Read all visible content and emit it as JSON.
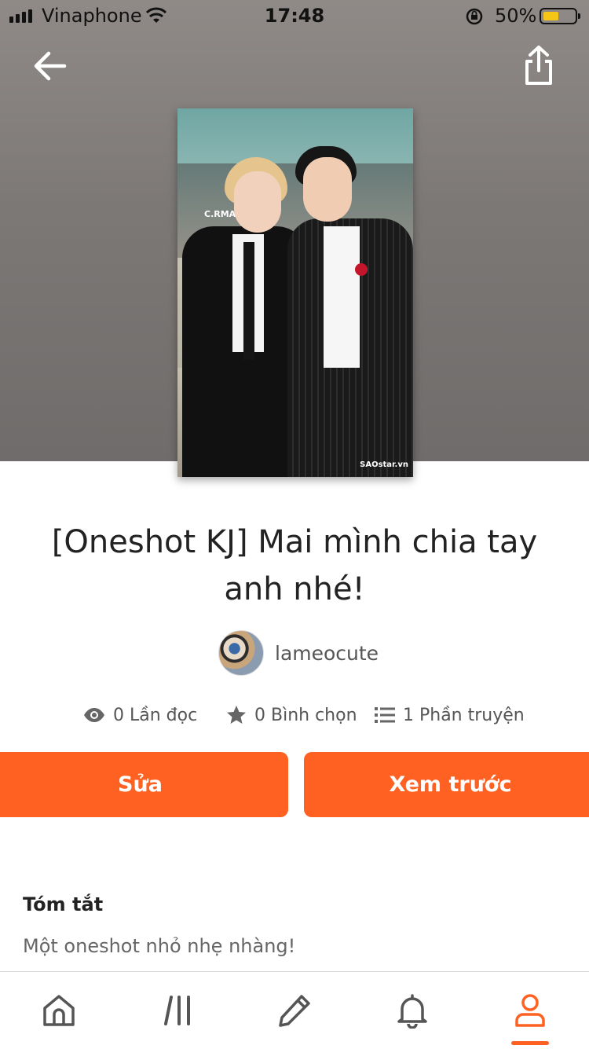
{
  "status_bar": {
    "carrier": "Vinaphone",
    "time": "17:48",
    "battery": "50%",
    "battery_level": 0.5
  },
  "header": {
    "back_icon": "arrow-left-icon",
    "share_icon": "share-icon"
  },
  "cover": {
    "sign_text": "C.RMAN",
    "watermark": "SAOstar.vn"
  },
  "story": {
    "title": "[Oneshot KJ] Mai mình chia tay anh nhé!",
    "author": "lameocute",
    "stats": {
      "reads": "0 Lần đọc",
      "votes": "0 Bình chọn",
      "parts": "1 Phần truyện"
    }
  },
  "actions": {
    "edit_label": "Sửa",
    "preview_label": "Xem trước"
  },
  "summary": {
    "heading": "Tóm tắt",
    "text": "Một oneshot nhỏ nhẹ nhàng!"
  },
  "tab_bar": {
    "items": [
      {
        "icon": "home-icon"
      },
      {
        "icon": "library-icon"
      },
      {
        "icon": "pencil-icon"
      },
      {
        "icon": "bell-icon"
      },
      {
        "icon": "profile-icon",
        "active": true
      }
    ],
    "accent": "#ff6122"
  },
  "colors": {
    "accent": "#ff6122",
    "battery_fill": "#f5c518"
  }
}
